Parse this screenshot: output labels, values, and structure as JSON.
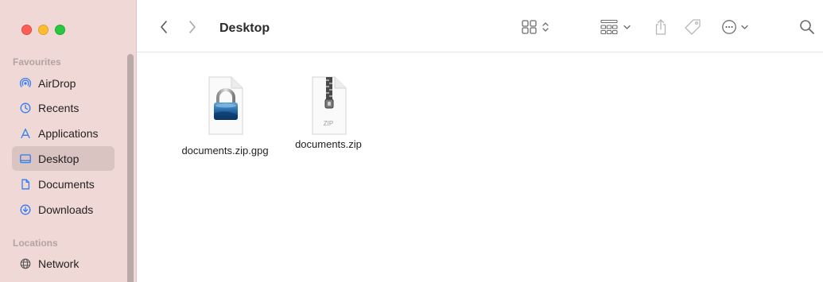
{
  "window": {
    "title": "Desktop"
  },
  "colors": {
    "sidebar_bg": "#efd8d6",
    "selected_bg": "#d9c4c2",
    "accent": "#2f7cf6"
  },
  "sidebar": {
    "sections": [
      {
        "title": "Favourites",
        "items": [
          {
            "label": "AirDrop",
            "icon": "airdrop-icon",
            "selected": false
          },
          {
            "label": "Recents",
            "icon": "clock-icon",
            "selected": false
          },
          {
            "label": "Applications",
            "icon": "applications-icon",
            "selected": false
          },
          {
            "label": "Desktop",
            "icon": "desktop-icon",
            "selected": true
          },
          {
            "label": "Documents",
            "icon": "document-icon",
            "selected": false
          },
          {
            "label": "Downloads",
            "icon": "download-icon",
            "selected": false
          }
        ]
      },
      {
        "title": "Locations",
        "items": [
          {
            "label": "Network",
            "icon": "network-icon",
            "selected": false
          }
        ]
      }
    ]
  },
  "toolbar": {
    "back_icon": "chevron-left-icon",
    "forward_icon": "chevron-right-icon",
    "view_icon": "grid-view-icon",
    "group_icon": "group-icon",
    "share_icon": "share-icon",
    "tag_icon": "tag-icon",
    "more_icon": "more-icon",
    "search_icon": "search-icon"
  },
  "files": [
    {
      "name": "documents.zip.gpg",
      "icon": "encrypted-file-icon"
    },
    {
      "name": "documents.zip",
      "icon": "zip-file-icon",
      "badge": "ZIP"
    }
  ]
}
